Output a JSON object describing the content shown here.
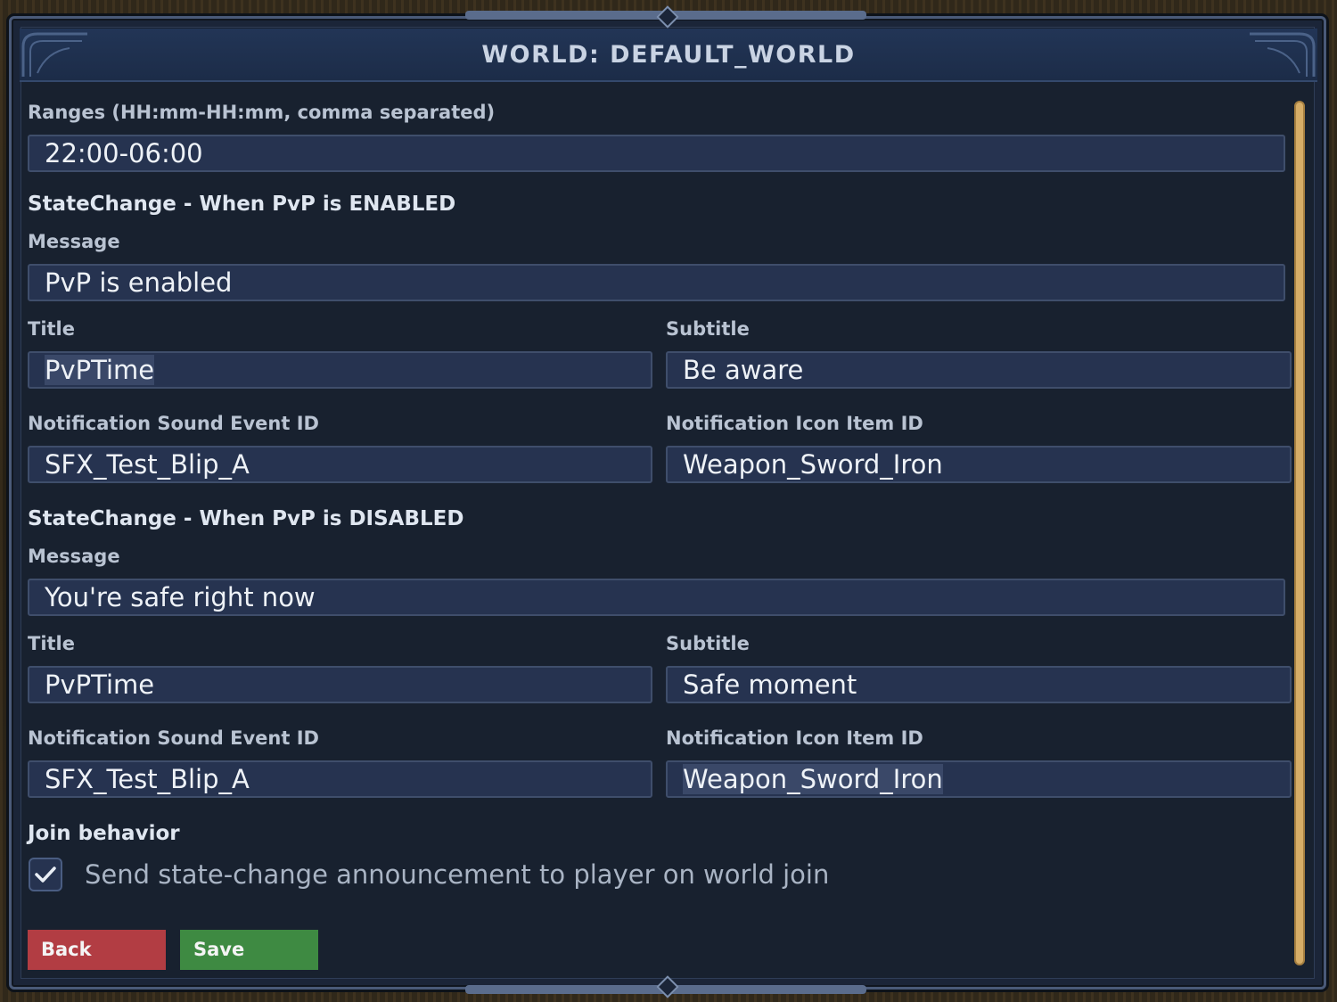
{
  "window": {
    "title": "WORLD: DEFAULT_WORLD"
  },
  "ranges": {
    "label": "Ranges (HH:mm-HH:mm, comma separated)",
    "value": "22:00-06:00"
  },
  "enabled": {
    "section_title": "StateChange - When PvP is ENABLED",
    "message_label": "Message",
    "message_value": "PvP is enabled",
    "title_label": "Title",
    "title_value": "PvPTime",
    "subtitle_label": "Subtitle",
    "subtitle_value": "Be aware",
    "sound_label": "Notification Sound Event ID",
    "sound_value": "SFX_Test_Blip_A",
    "icon_label": "Notification Icon Item ID",
    "icon_value": "Weapon_Sword_Iron"
  },
  "disabled": {
    "section_title": "StateChange - When PvP is DISABLED",
    "message_label": "Message",
    "message_value": "You're safe right now",
    "title_label": "Title",
    "title_value": "PvPTime",
    "subtitle_label": "Subtitle",
    "subtitle_value": "Safe moment",
    "sound_label": "Notification Sound Event ID",
    "sound_value": "SFX_Test_Blip_A",
    "icon_label": "Notification Icon Item ID",
    "icon_value": "Weapon_Sword_Iron"
  },
  "join": {
    "section_title": "Join behavior",
    "checkbox_label": "Send state-change announcement to player on world join",
    "checked": true
  },
  "buttons": {
    "back_label": "Back",
    "save_label": "Save"
  },
  "colors": {
    "back_button": "#b23d43",
    "save_button": "#3e8a42",
    "scrollbar": "#d6ad67",
    "header": "#223556"
  },
  "icons": {
    "checkbox": "checkmark-icon"
  }
}
